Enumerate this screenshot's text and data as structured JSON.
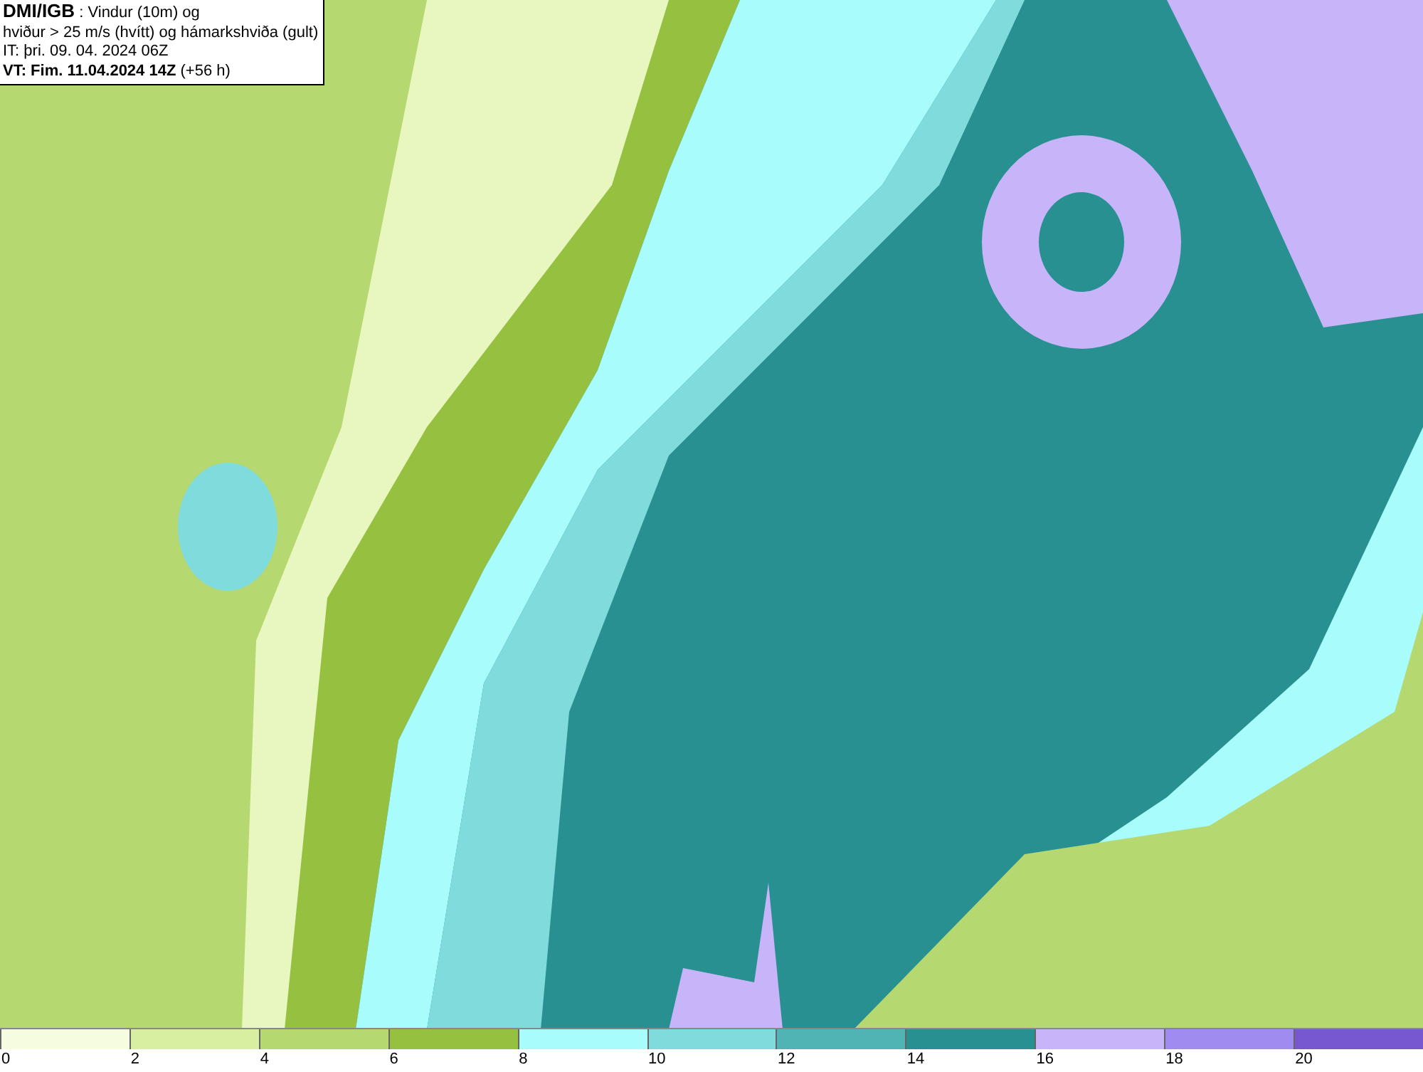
{
  "info_box": {
    "lines": [
      "**DMI/IGB** : Vindur (10m) og",
      "hviður > 25 m/s (hvítt) og hámarkshviða (gult)",
      "IT: þri. 09. 04. 2024 06Z",
      "**VT: Fim. 11.04.2024 14Z** (+56 h)"
    ]
  },
  "legend": [
    {
      "label": "0",
      "color": "#f5fce0"
    },
    {
      "label": "2",
      "color": "#d8eea0"
    },
    {
      "label": "4",
      "color": "#b5d870"
    },
    {
      "label": "6",
      "color": "#96c040"
    },
    {
      "label": "8",
      "color": "#a8fcfc"
    },
    {
      "label": "10",
      "color": "#80dcdc"
    },
    {
      "label": "12",
      "color": "#50b4b4"
    },
    {
      "label": "14",
      "color": "#289090"
    },
    {
      "label": "16",
      "color": "#c8b4f8"
    },
    {
      "label": "18",
      "color": "#a08cf0"
    },
    {
      "label": "20",
      "color": "#7858d0"
    }
  ]
}
